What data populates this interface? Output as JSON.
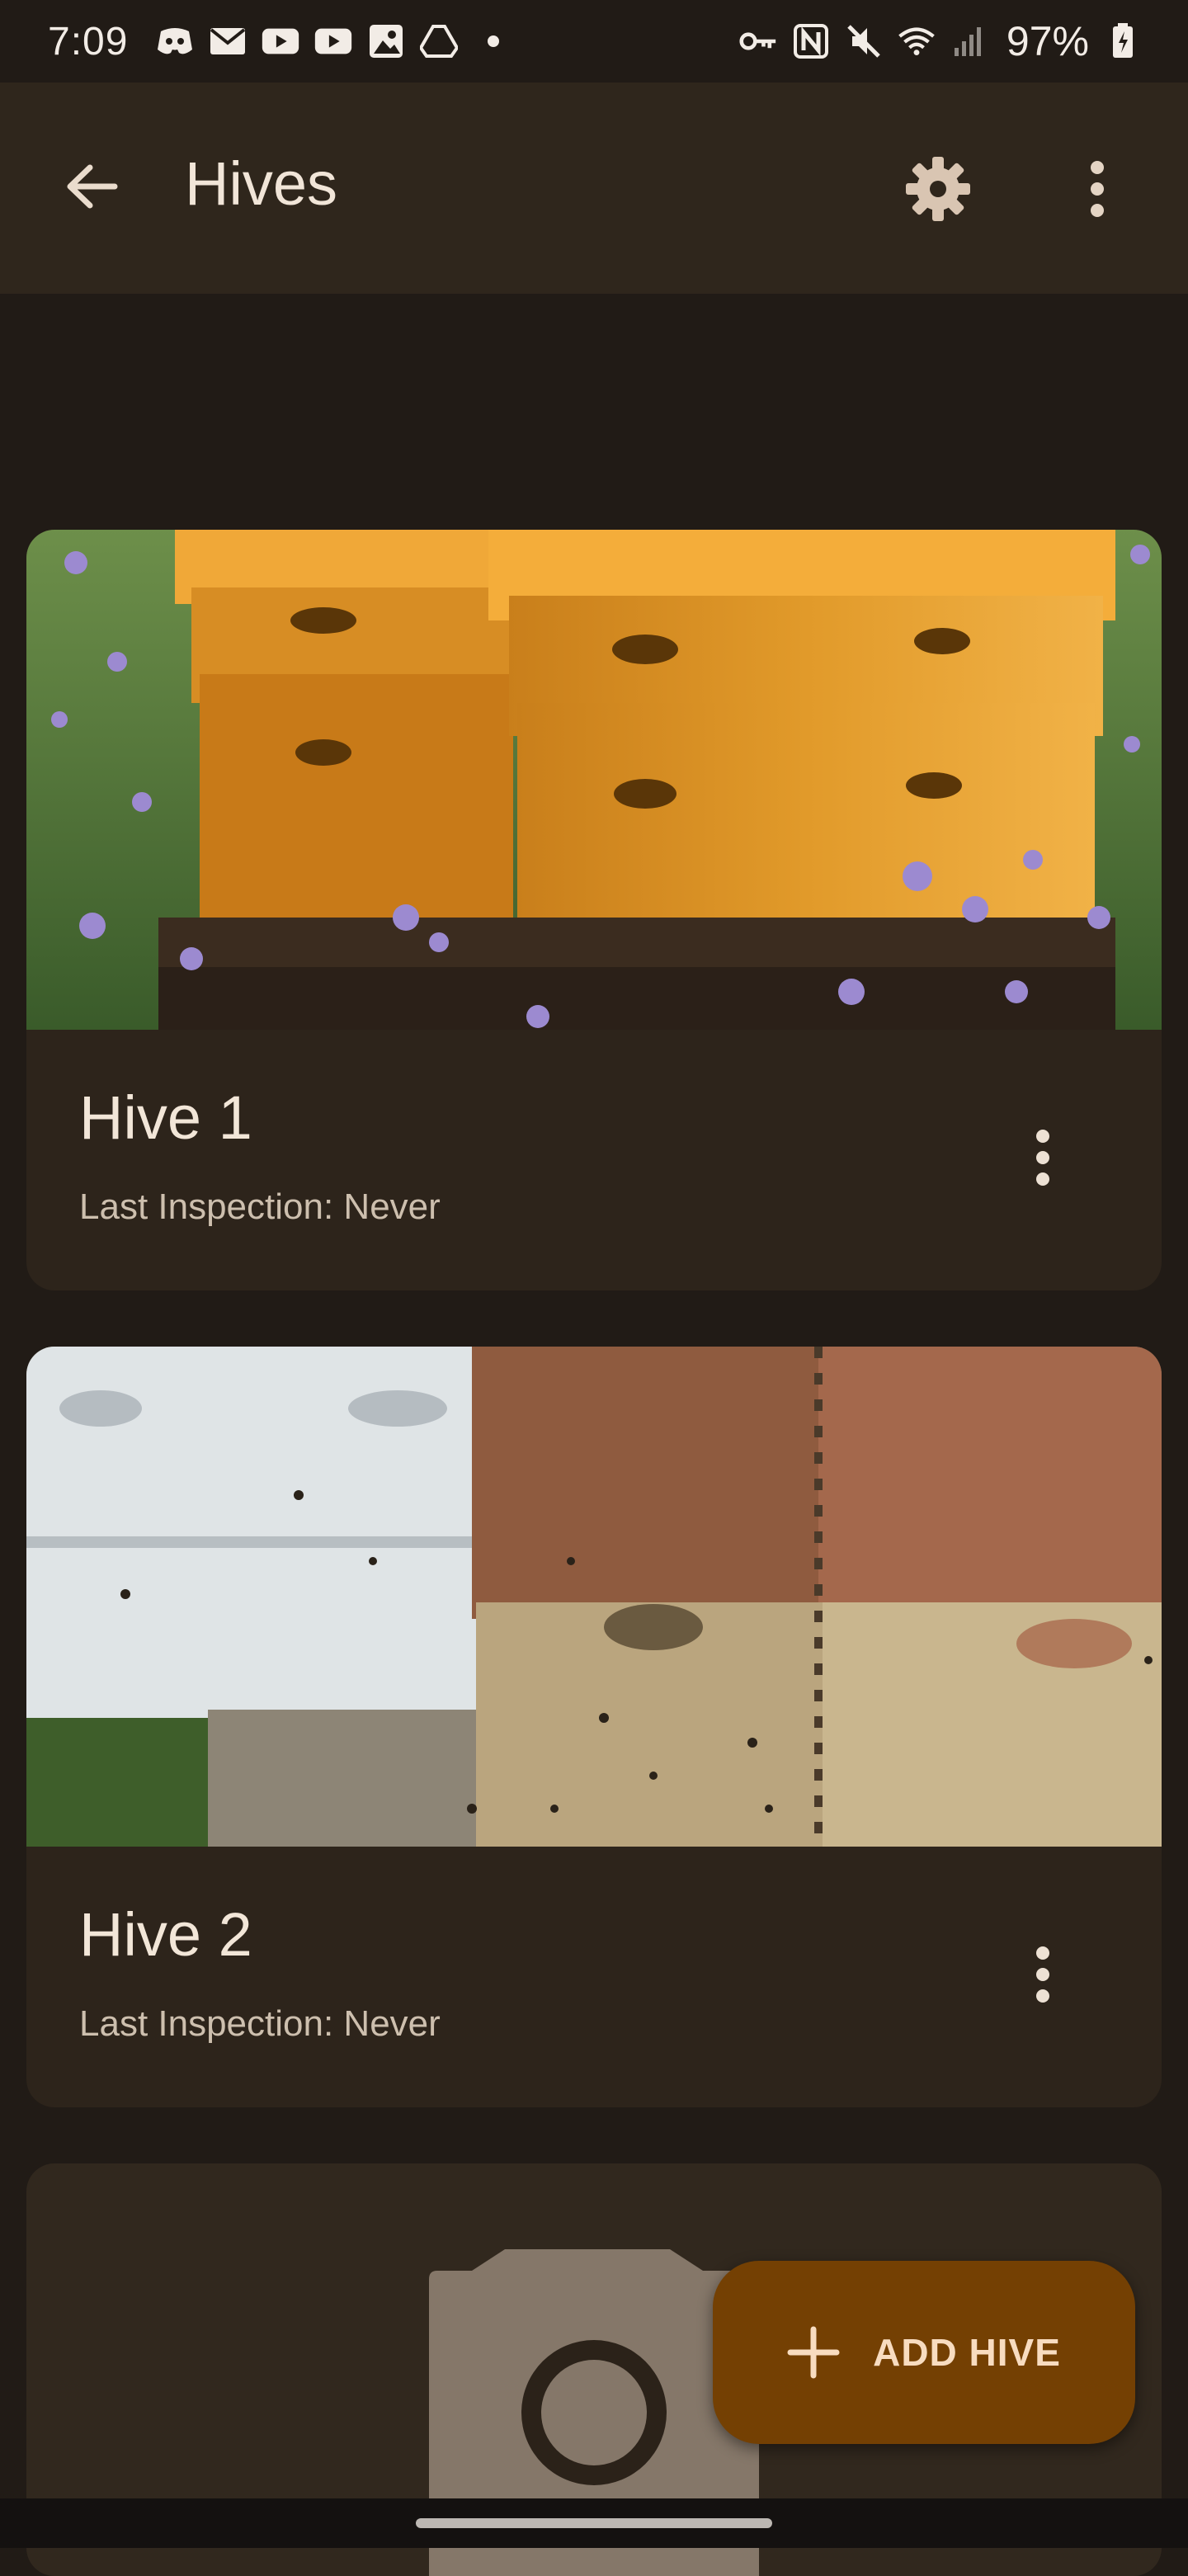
{
  "status_bar": {
    "time": "7:09",
    "battery": "97%",
    "left_icons": [
      "discord-icon",
      "mail-icon",
      "youtube-icon",
      "youtube-icon",
      "photos-icon",
      "drive-icon"
    ],
    "right_icons": [
      "vpn-key-icon",
      "nfc-icon",
      "mute-icon",
      "wifi-icon",
      "signal-icon",
      "battery-charging-icon"
    ]
  },
  "app_bar": {
    "title": "Hives"
  },
  "hives": [
    {
      "name": "Hive 1",
      "last_inspection": "Last Inspection: Never"
    },
    {
      "name": "Hive 2",
      "last_inspection": "Last Inspection: Never"
    }
  ],
  "fab": {
    "label": "ADD HIVE"
  },
  "colors": {
    "background": "#211b16",
    "app_bar": "#2f261c",
    "card": "#2d241b",
    "fab": "#744003",
    "fab_text": "#f8dcc0"
  }
}
